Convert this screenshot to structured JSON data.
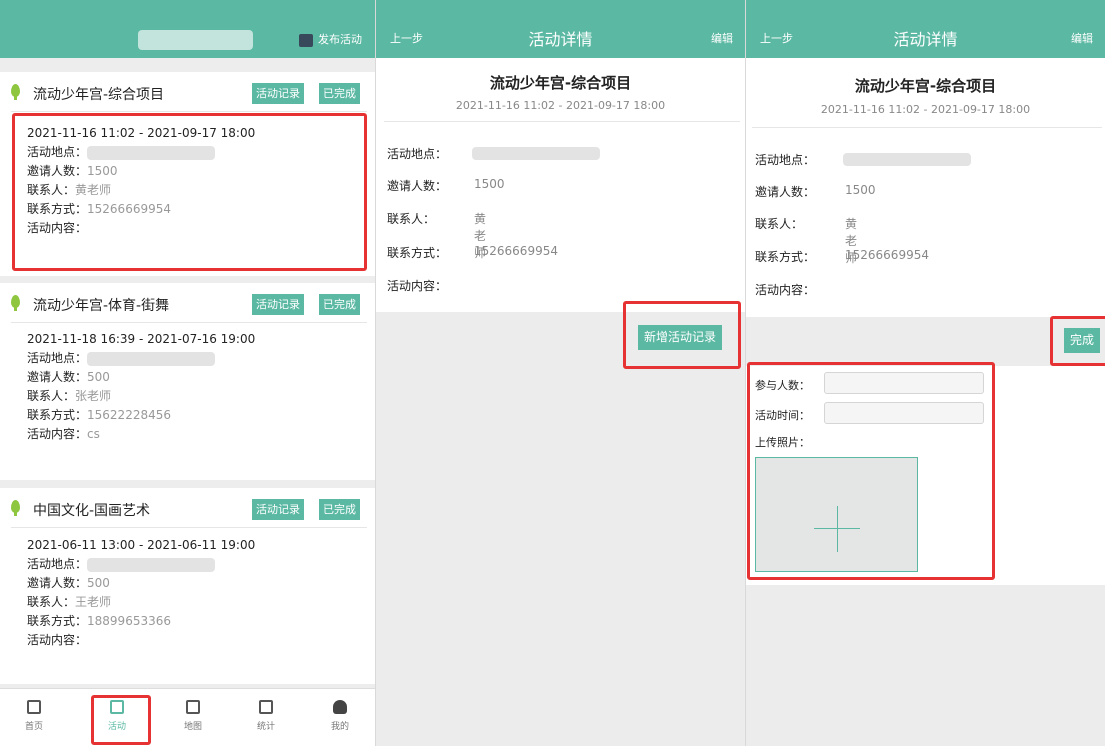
{
  "list_panel": {
    "header": {
      "publish_label": "发布活动"
    },
    "cards": [
      {
        "title": "流动少年宫-综合项目",
        "record_label": "活动记录",
        "done_label": "已完成",
        "date_range": "2021-11-16 11:02 - 2021-09-17 18:00",
        "location_label": "活动地点：",
        "invited_label": "邀请人数：",
        "invited_value": "1500",
        "contact_label": "联系人：",
        "contact_value": "黄老师",
        "phone_label": "联系方式：",
        "phone_value": "15266669954",
        "content_label": "活动内容：",
        "content_value": ""
      },
      {
        "title": "流动少年宫-体育-街舞",
        "record_label": "活动记录",
        "done_label": "已完成",
        "date_range": "2021-11-18 16:39 - 2021-07-16 19:00",
        "location_label": "活动地点：",
        "invited_label": "邀请人数：",
        "invited_value": "500",
        "contact_label": "联系人：",
        "contact_value": "张老师",
        "phone_label": "联系方式：",
        "phone_value": "15622228456",
        "content_label": "活动内容：",
        "content_value": "cs"
      },
      {
        "title": "中国文化-国画艺术",
        "record_label": "活动记录",
        "done_label": "已完成",
        "date_range": "2021-06-11 13:00 - 2021-06-11 19:00",
        "location_label": "活动地点：",
        "invited_label": "邀请人数：",
        "invited_value": "500",
        "contact_label": "联系人：",
        "contact_value": "王老师",
        "phone_label": "联系方式：",
        "phone_value": "18899653366",
        "content_label": "活动内容：",
        "content_value": ""
      }
    ],
    "nav": [
      "首页",
      "活动",
      "地图",
      "统计",
      "我的"
    ]
  },
  "detail": {
    "back_label": "上一步",
    "title": "活动详情",
    "edit_label": "编辑",
    "activity_title": "流动少年宫-综合项目",
    "date_range": "2021-11-16 11:02 - 2021-09-17 18:00",
    "location_label": "活动地点：",
    "invited_label": "邀请人数：",
    "invited_value": "1500",
    "contact_label": "联系人：",
    "contact_value": "黄老师",
    "phone_label": "联系方式：",
    "phone_value": "15266669954",
    "content_label": "活动内容：",
    "add_record_label": "新增活动记录",
    "finish_label": "完成",
    "participants_label": "参与人数：",
    "time_label": "活动时间：",
    "upload_label": "上传照片："
  },
  "colors": {
    "accent": "#5bb8a3",
    "highlight": "#e63232"
  }
}
